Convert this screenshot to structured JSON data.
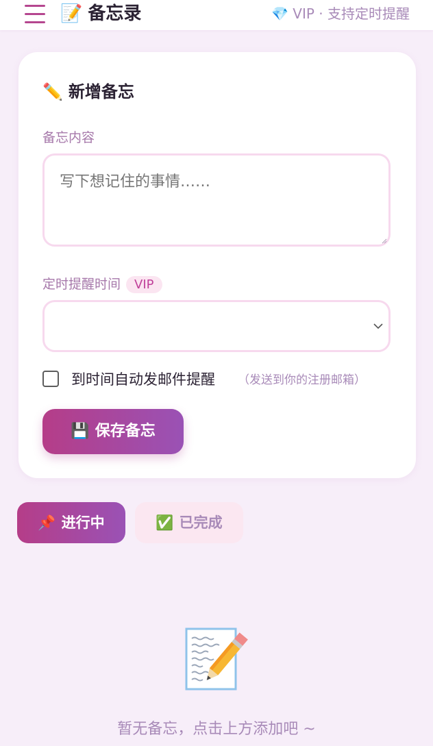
{
  "header": {
    "title": "备忘录",
    "title_emoji": "📝",
    "vip_emoji": "💎",
    "vip_text": "VIP · 支持定时提醒"
  },
  "form": {
    "title_emoji": "✏️",
    "title": "新增备忘",
    "content_label": "备忘内容",
    "content_placeholder": "写下想记住的事情……",
    "content_value": "",
    "reminder_label": "定时提醒时间",
    "vip_badge": "VIP",
    "reminder_value": "",
    "email_checkbox_label": "到时间自动发邮件提醒",
    "email_checkbox_hint": "（发送到你的注册邮箱）",
    "email_checked": false,
    "save_emoji": "💾",
    "save_label": "保存备忘"
  },
  "tabs": [
    {
      "emoji": "📌",
      "label": "进行中",
      "active": true
    },
    {
      "emoji": "✅",
      "label": "已完成",
      "active": false
    }
  ],
  "empty_state": {
    "icon": "memo-pencil-icon",
    "text": "暂无备忘，点击上方添加吧 ~"
  },
  "colors": {
    "accent": "#b53d88",
    "accent_end": "#9a52b5",
    "background": "#f7eef9",
    "muted": "#a88ab8"
  }
}
